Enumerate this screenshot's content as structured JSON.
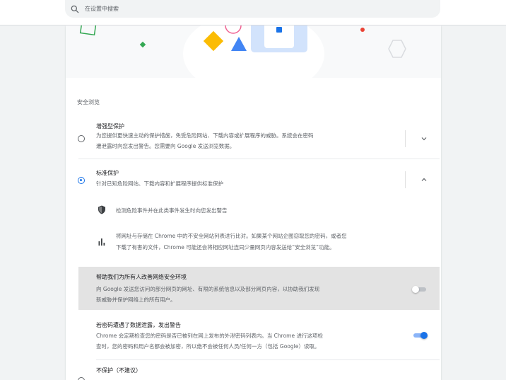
{
  "search": {
    "placeholder": "在设置中搜索"
  },
  "safe_browsing": {
    "section_title": "安全浏览",
    "enhanced": {
      "title": "增强型保护",
      "desc_line1": "为您提供更快速主动的保护措施，免受危险网站、下载内容或扩展程序的威胁。系统会在密码",
      "desc_line2": "遭泄露时向您发出警告。您需要向 Google 发送浏览数据。"
    },
    "standard": {
      "title": "标准保护",
      "desc": "针对已知危险网站、下载内容和扩展程序提供标准保护",
      "detail1": "检测危险事件并在此类事件发生时向您发出警告",
      "detail2_line1": "将网址与存储在 Chrome 中的不安全网站列表进行比对。如果某个网站企图窃取您的密码，或者您",
      "detail2_line2": "下载了有害的文件，Chrome 可能还会将相应网址连同少量网页内容发送给“安全浏览”功能。"
    },
    "help_improve": {
      "title": "帮助我们为所有人改善网络安全环境",
      "desc_line1": "向 Google 发送您访问的部分网页的网址、有限的系统信息以及部分网页内容，以协助我们发现",
      "desc_line2": "新威胁并保护网络上的所有用户。",
      "enabled": false
    },
    "password_leak": {
      "title": "若密码遭遇了数据泄露，发出警告",
      "desc_line1": "Chrome 会定期检查您的密码是否已被列在网上发布的外泄密码列表内。当 Chrome 进行这项检",
      "desc_line2": "查时，您的密码和用户名都会被加密，所以绝不会被任何人员/任何一方（包括 Google）读取。",
      "enabled": true
    },
    "no_protection": {
      "title": "不保护（不建议）"
    }
  },
  "colors": {
    "accent": "#1a73e8",
    "hero_blue": "#4285f4",
    "hero_yellow": "#fbbc04",
    "hero_red": "#ea4335",
    "hero_green": "#34a853"
  }
}
